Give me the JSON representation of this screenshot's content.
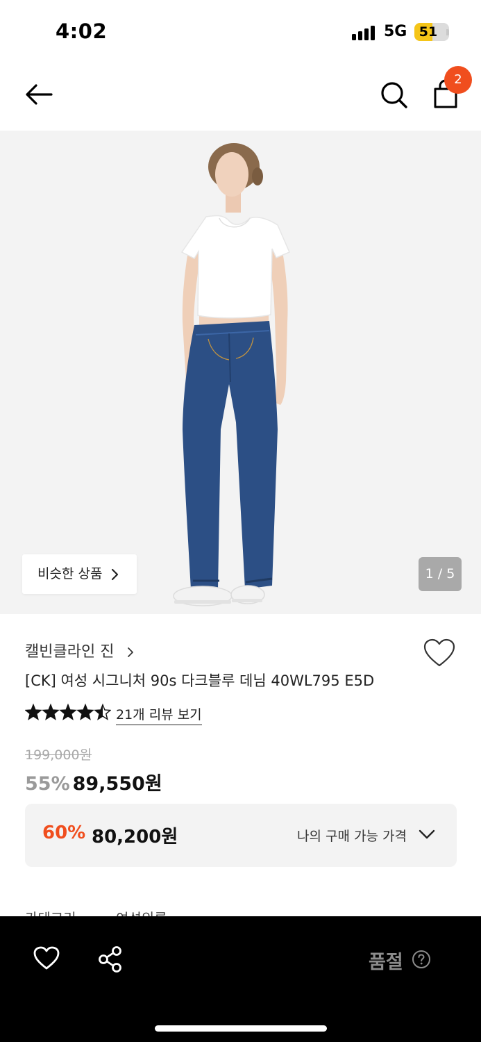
{
  "status_bar": {
    "time": "4:02",
    "network": "5G",
    "battery": "51",
    "battery_level": 0.51
  },
  "nav": {
    "back_icon": "arrow-left-icon",
    "search_icon": "search-icon",
    "cart_icon": "shopping-bag-icon",
    "cart_count": "2"
  },
  "hero": {
    "similar_label": "비슷한 상품",
    "counter": "1 / 5",
    "colors": {
      "background": "#f3f3f3",
      "tshirt": "#ffffff",
      "denim": "#2c4f85",
      "sneakers": "#f2f2f2"
    }
  },
  "product": {
    "brand": "캘빈클라인 진",
    "title": "[CK] 여성 시그니처 90s 다크블루 데님 40WL795 E5D",
    "rating": 4.5,
    "rating_max": 5,
    "review_link": "21개 리뷰 보기",
    "original_price": "199,000원",
    "discount_pct": "55%",
    "sale_price": "89,550원"
  },
  "member_price": {
    "discount_pct": "60%",
    "price": "80,200원",
    "label": "나의 구매 가능 가격"
  },
  "clipped": {
    "left": "카테고리",
    "right": "여성의류"
  },
  "bottom_bar": {
    "soldout_label": "품절",
    "wish_icon": "heart-icon",
    "share_icon": "share-icon",
    "help_icon": "question-circle-icon"
  },
  "colors": {
    "accent": "#f04e1e",
    "badge": "#f04e1e",
    "muted": "#9a9a9a",
    "bar": "#000000"
  }
}
